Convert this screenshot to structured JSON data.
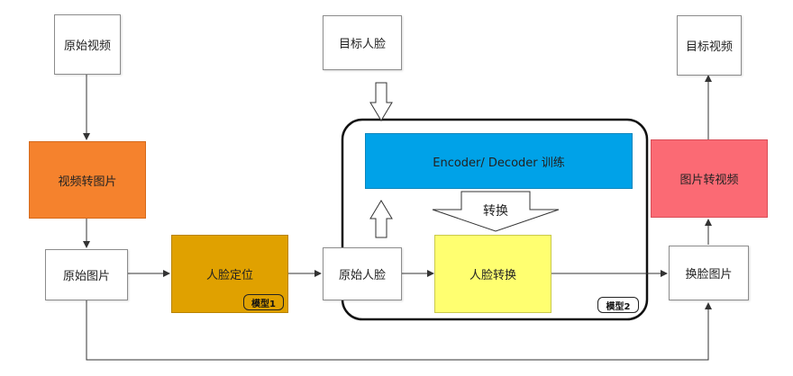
{
  "nodes": {
    "source_video": "原始视频",
    "video_to_images": "视频转图片",
    "source_images": "原始图片",
    "face_locate": "人脸定位",
    "model1": "模型1",
    "source_face": "原始人脸",
    "target_face": "目标人脸",
    "encoder_decoder": "Encoder/ Decoder 训练",
    "convert": "转换",
    "face_swap": "人脸转换",
    "model2": "模型2",
    "swapped_images": "换脸图片",
    "images_to_video": "图片转视频",
    "target_video": "目标视频"
  },
  "colors": {
    "video_to_images": "#f5822d",
    "face_locate": "#e0a100",
    "encoder_decoder": "#00a2e8",
    "face_swap": "#ffff70",
    "images_to_video": "#fb6a74",
    "border": "#8c8c8c",
    "arrow": "#333333"
  }
}
